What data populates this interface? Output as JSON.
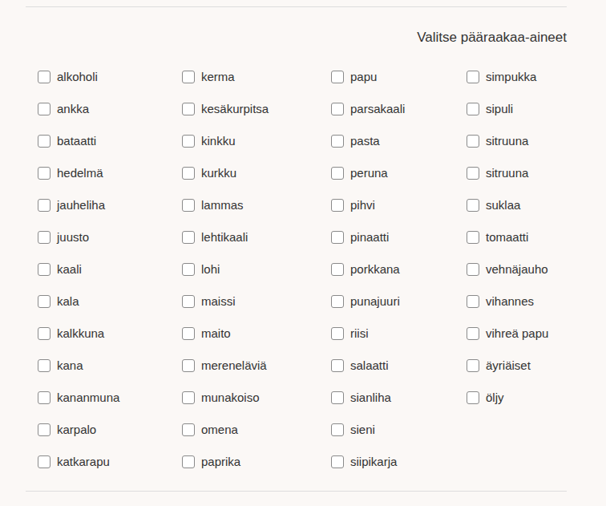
{
  "title": "Valitse pääraakaa-aineet",
  "columns": [
    [
      {
        "label": "alkoholi",
        "checked": false
      },
      {
        "label": "ankka",
        "checked": false
      },
      {
        "label": "bataatti",
        "checked": false
      },
      {
        "label": "hedelmä",
        "checked": false
      },
      {
        "label": "jauheliha",
        "checked": false
      },
      {
        "label": "juusto",
        "checked": false
      },
      {
        "label": "kaali",
        "checked": false
      },
      {
        "label": "kala",
        "checked": false
      },
      {
        "label": "kalkkuna",
        "checked": false
      },
      {
        "label": "kana",
        "checked": false
      },
      {
        "label": "kananmuna",
        "checked": false
      },
      {
        "label": "karpalo",
        "checked": false
      },
      {
        "label": "katkarapu",
        "checked": false
      }
    ],
    [
      {
        "label": "kerma",
        "checked": false
      },
      {
        "label": "kesäkurpitsa",
        "checked": false
      },
      {
        "label": "kinkku",
        "checked": false
      },
      {
        "label": "kurkku",
        "checked": false
      },
      {
        "label": "lammas",
        "checked": false
      },
      {
        "label": "lehtikaali",
        "checked": false
      },
      {
        "label": "lohi",
        "checked": false
      },
      {
        "label": "maissi",
        "checked": false
      },
      {
        "label": "maito",
        "checked": false
      },
      {
        "label": "mereneläviä",
        "checked": false
      },
      {
        "label": "munakoiso",
        "checked": false
      },
      {
        "label": "omena",
        "checked": false
      },
      {
        "label": "paprika",
        "checked": false
      }
    ],
    [
      {
        "label": "papu",
        "checked": false
      },
      {
        "label": "parsakaali",
        "checked": false
      },
      {
        "label": "pasta",
        "checked": false
      },
      {
        "label": "peruna",
        "checked": false
      },
      {
        "label": "pihvi",
        "checked": false
      },
      {
        "label": "pinaatti",
        "checked": false
      },
      {
        "label": "porkkana",
        "checked": false
      },
      {
        "label": "punajuuri",
        "checked": false
      },
      {
        "label": "riisi",
        "checked": false
      },
      {
        "label": "salaatti",
        "checked": false
      },
      {
        "label": "sianliha",
        "checked": false
      },
      {
        "label": "sieni",
        "checked": false
      },
      {
        "label": "siipikarja",
        "checked": false
      }
    ],
    [
      {
        "label": "simpukka",
        "checked": false
      },
      {
        "label": "sipuli",
        "checked": false
      },
      {
        "label": "sitruuna",
        "checked": false
      },
      {
        "label": "sitruuna",
        "checked": false
      },
      {
        "label": "suklaa",
        "checked": false
      },
      {
        "label": "tomaatti",
        "checked": false
      },
      {
        "label": "vehnäjauho",
        "checked": false
      },
      {
        "label": "vihannes",
        "checked": false
      },
      {
        "label": "vihreä papu",
        "checked": false
      },
      {
        "label": "äyriäiset",
        "checked": false
      },
      {
        "label": "öljy",
        "checked": false
      }
    ]
  ]
}
